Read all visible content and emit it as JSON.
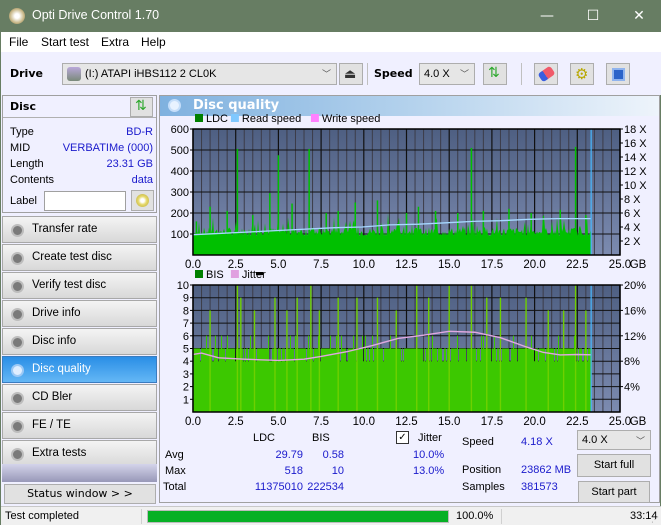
{
  "window": {
    "title": "Opti Drive Control 1.70",
    "minimize": "—",
    "maximize": "☐",
    "close": "✕"
  },
  "menu": [
    "File",
    "Start test",
    "Extra",
    "Help"
  ],
  "toolbar": {
    "drive_label": "Drive",
    "drive_value": "(I:)  ATAPI iHBS112   2 CL0K",
    "speed_label": "Speed",
    "speed_value": "4.0 X"
  },
  "disc": {
    "header": "Disc",
    "type_label": "Type",
    "type_value": "BD-R",
    "mid_label": "MID",
    "mid_value": "VERBATIMe (000)",
    "length_label": "Length",
    "length_value": "23.31 GB",
    "contents_label": "Contents",
    "contents_value": "data",
    "label_label": "Label",
    "label_value": ""
  },
  "nav": [
    {
      "label": "Transfer rate",
      "active": false
    },
    {
      "label": "Create test disc",
      "active": false
    },
    {
      "label": "Verify test disc",
      "active": false
    },
    {
      "label": "Drive info",
      "active": false
    },
    {
      "label": "Disc info",
      "active": false
    },
    {
      "label": "Disc quality",
      "active": true
    },
    {
      "label": "CD Bler",
      "active": false
    },
    {
      "label": "FE / TE",
      "active": false
    },
    {
      "label": "Extra tests",
      "active": false
    }
  ],
  "status_window_button": "Status window > >",
  "panel_title": "Disc quality",
  "chart_data": [
    {
      "type": "area",
      "title": "LDC / Read speed",
      "legend": [
        "LDC",
        "Read speed",
        "Write speed"
      ],
      "legend_colors": [
        "#008000",
        "#80c8ff",
        "#ff80ff"
      ],
      "x_ticks": [
        "0.0",
        "2.5",
        "5.0",
        "7.5",
        "10.0",
        "12.5",
        "15.0",
        "17.5",
        "20.0",
        "22.5",
        "25.0"
      ],
      "x_unit": "GB",
      "xlim": [
        0,
        25
      ],
      "ylim_left": [
        0,
        600
      ],
      "y_ticks_left": [
        "100",
        "200",
        "300",
        "400",
        "500",
        "600"
      ],
      "ylim_right": [
        0,
        18
      ],
      "y_ticks_right": [
        "2 X",
        "4 X",
        "6 X",
        "8 X",
        "10 X",
        "12 X",
        "14 X",
        "16 X",
        "18 X"
      ],
      "data_end_gb": 23.31,
      "ldc_baseline": 120,
      "ldc_spikes": [
        [
          0.2,
          160
        ],
        [
          1.0,
          230
        ],
        [
          2.0,
          210
        ],
        [
          2.6,
          505
        ],
        [
          3.5,
          190
        ],
        [
          4.5,
          295
        ],
        [
          5.0,
          475
        ],
        [
          5.8,
          245
        ],
        [
          6.8,
          505
        ],
        [
          7.8,
          200
        ],
        [
          8.5,
          210
        ],
        [
          9.5,
          250
        ],
        [
          10.8,
          260
        ],
        [
          12.5,
          200
        ],
        [
          13.2,
          230
        ],
        [
          14.2,
          210
        ],
        [
          15.5,
          200
        ],
        [
          16.3,
          510
        ],
        [
          17.0,
          210
        ],
        [
          18.5,
          220
        ],
        [
          19.8,
          200
        ],
        [
          21.5,
          215
        ],
        [
          22.4,
          515
        ],
        [
          23.0,
          190
        ]
      ],
      "read_speed": [
        [
          0,
          2.9
        ],
        [
          1.7,
          3.1
        ],
        [
          3.4,
          3.3
        ],
        [
          5.0,
          3.5
        ],
        [
          6.6,
          3.7
        ],
        [
          8.3,
          3.9
        ],
        [
          9.9,
          4.0
        ],
        [
          11.5,
          4.3
        ],
        [
          13.2,
          4.4
        ],
        [
          14.8,
          4.6
        ],
        [
          16.4,
          4.8
        ],
        [
          18.0,
          4.9
        ],
        [
          19.7,
          5.1
        ],
        [
          21.3,
          5.2
        ],
        [
          23.3,
          5.2
        ]
      ]
    },
    {
      "type": "area",
      "title": "BIS / Jitter",
      "legend": [
        "BIS",
        "Jitter"
      ],
      "legend_colors": [
        "#008000",
        "#e0a0e0"
      ],
      "x_ticks": [
        "0.0",
        "2.5",
        "5.0",
        "7.5",
        "10.0",
        "12.5",
        "15.0",
        "17.5",
        "20.0",
        "22.5",
        "25.0"
      ],
      "x_unit": "GB",
      "xlim": [
        0,
        25
      ],
      "ylim_left": [
        0,
        10
      ],
      "y_ticks_left": [
        "1",
        "2",
        "3",
        "4",
        "5",
        "6",
        "7",
        "8",
        "9",
        "10"
      ],
      "ylim_right": [
        0,
        20
      ],
      "y_ticks_right": [
        "4%",
        "8%",
        "12%",
        "16%",
        "20%"
      ],
      "data_end_gb": 23.31,
      "bis_baseline": 5,
      "bis_spikes": [
        [
          1.0,
          8
        ],
        [
          2.6,
          10
        ],
        [
          2.8,
          9
        ],
        [
          3.6,
          8
        ],
        [
          4.8,
          9
        ],
        [
          5.5,
          8
        ],
        [
          6.1,
          9
        ],
        [
          6.9,
          10
        ],
        [
          7.4,
          8
        ],
        [
          8.5,
          9
        ],
        [
          9.6,
          9
        ],
        [
          10.8,
          9
        ],
        [
          11.9,
          8
        ],
        [
          13.1,
          10
        ],
        [
          13.8,
          9
        ],
        [
          15.0,
          10
        ],
        [
          16.3,
          10
        ],
        [
          17.2,
          9
        ],
        [
          18.0,
          9
        ],
        [
          19.5,
          9
        ],
        [
          20.8,
          8
        ],
        [
          21.7,
          8
        ],
        [
          22.4,
          10
        ],
        [
          23.0,
          8
        ]
      ],
      "jitter_pct": [
        [
          0,
          9.0
        ],
        [
          0.5,
          9.4
        ],
        [
          1.5,
          8.4
        ],
        [
          3,
          8.2
        ],
        [
          5,
          8.1
        ],
        [
          6.5,
          8.4
        ],
        [
          7.5,
          8.8
        ],
        [
          9,
          9.6
        ],
        [
          10.5,
          10.6
        ],
        [
          12,
          11.6
        ],
        [
          13.5,
          12.2
        ],
        [
          15,
          12.6
        ],
        [
          16.5,
          12.5
        ],
        [
          18,
          11.8
        ],
        [
          19.5,
          10.4
        ],
        [
          20.5,
          9.4
        ],
        [
          21.5,
          9.0
        ],
        [
          22.5,
          9.2
        ],
        [
          23.3,
          9.1
        ]
      ]
    }
  ],
  "stats": {
    "col_ldc": "LDC",
    "col_bis": "BIS",
    "col_jitter": "Jitter",
    "jitter_checked": true,
    "avg_label": "Avg",
    "max_label": "Max",
    "total_label": "Total",
    "avg_ldc": "29.79",
    "avg_bis": "0.58",
    "avg_jitter": "10.0%",
    "max_ldc": "518",
    "max_bis": "10",
    "max_jitter": "13.0%",
    "total_ldc": "11375010",
    "total_bis": "222534",
    "speed_label": "Speed",
    "speed_value": "4.18 X",
    "position_label": "Position",
    "position_value": "23862 MB",
    "samples_label": "Samples",
    "samples_value": "381573",
    "speed_select": "4.0 X",
    "start_full": "Start full",
    "start_part": "Start part"
  },
  "statusbar": {
    "text": "Test completed",
    "progress_pct": 100.0,
    "progress_text": "100.0%",
    "time": "33:14"
  }
}
